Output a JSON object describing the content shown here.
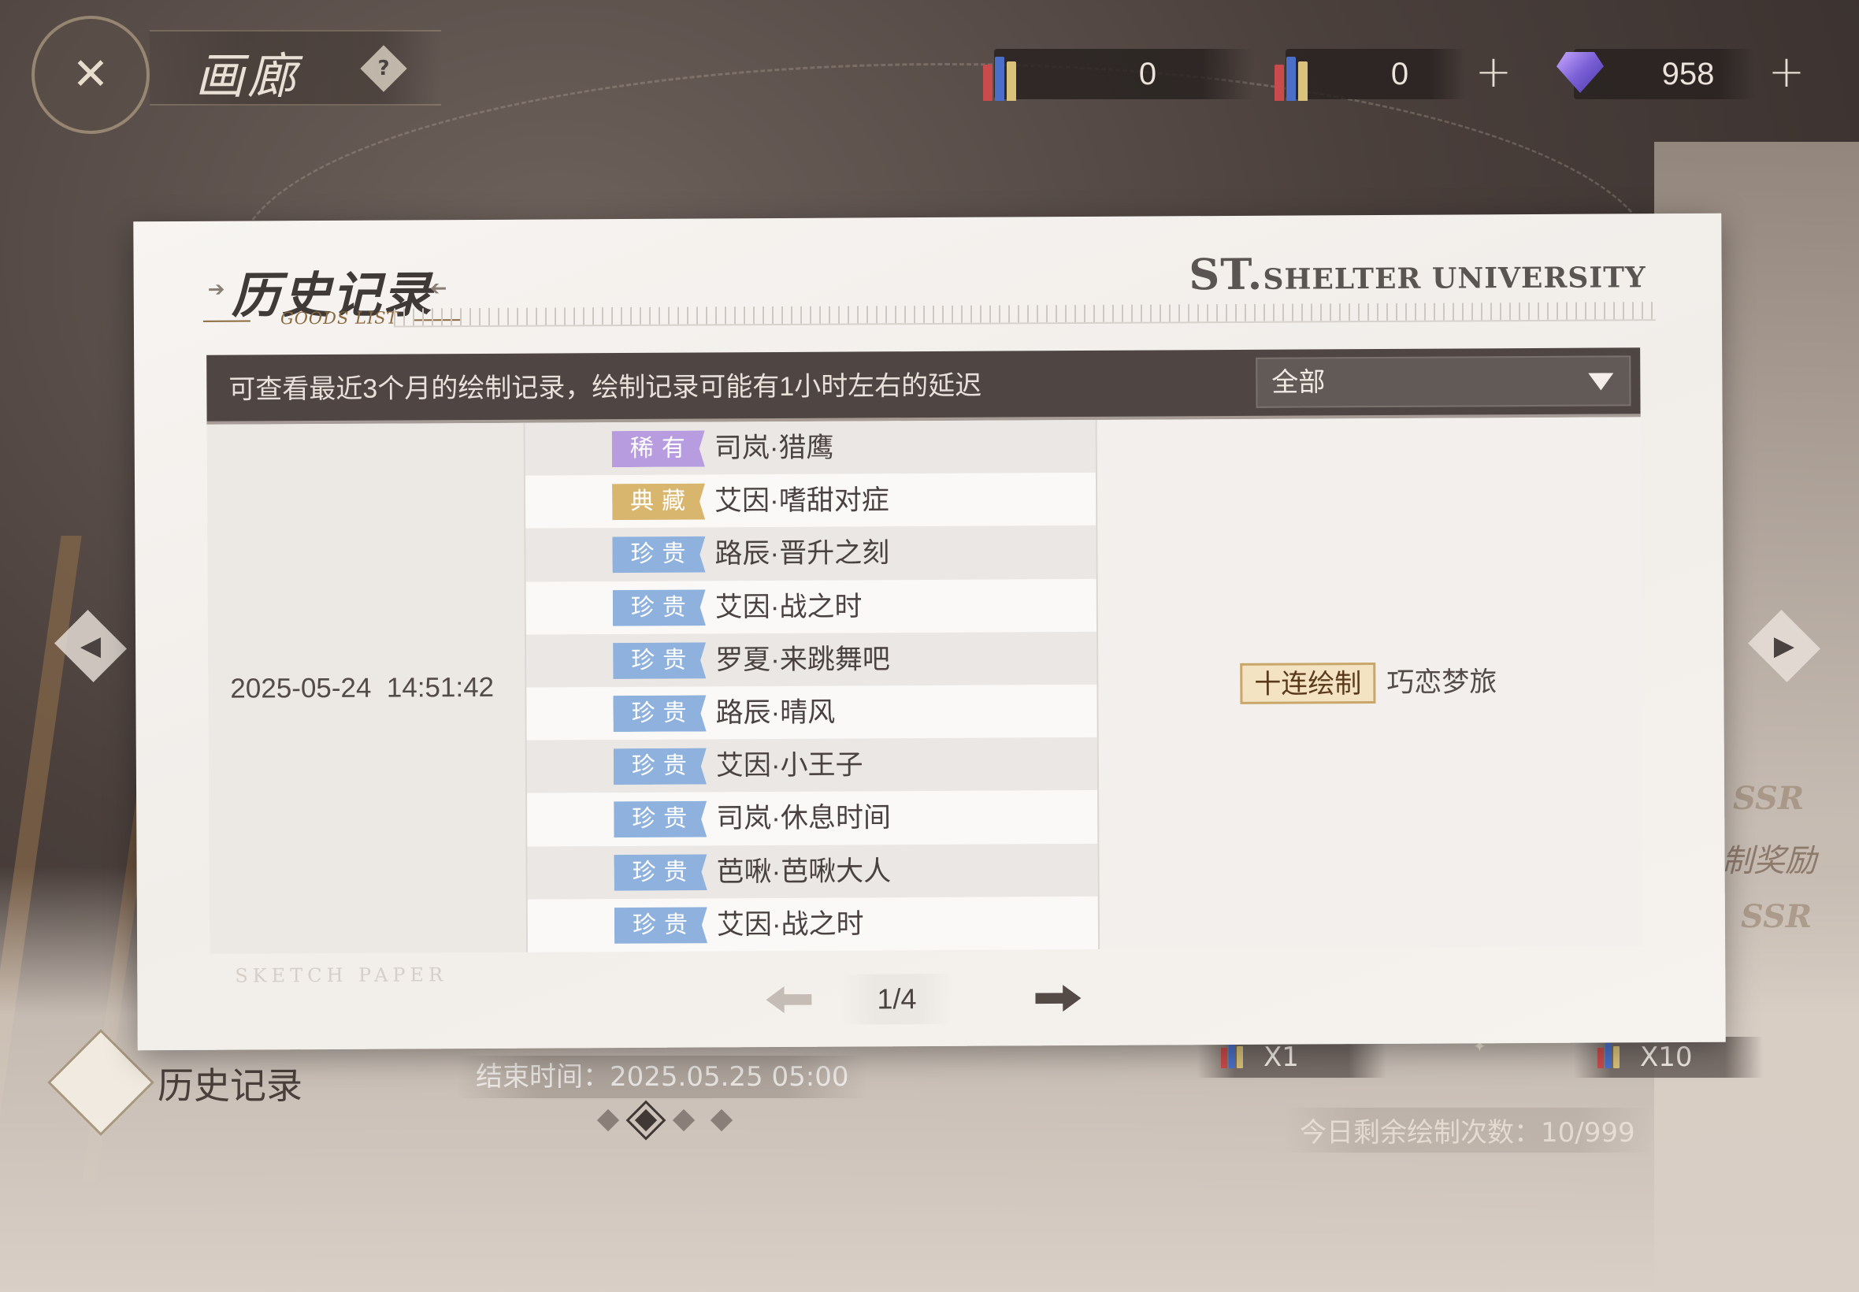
{
  "header": {
    "title": "画廊",
    "help_icon": "question-diamond-icon"
  },
  "currencies": [
    {
      "name": "paint-ticket-icon",
      "value": "0",
      "has_plus": false
    },
    {
      "name": "paint-ticket-icon",
      "value": "0",
      "has_plus": true
    },
    {
      "name": "diamond-gem-icon",
      "value": "958",
      "has_plus": true
    }
  ],
  "plus_label": "+",
  "modal": {
    "title": "历史记录",
    "subtitle": "GOODS LIST",
    "brand_prefix": "ST.",
    "brand_name": "SHELTER UNIVERSITY",
    "info_text": "可查看最近3个月的绘制记录，绘制记录可能有1小时左右的延迟",
    "filter_value": "全部",
    "record": {
      "datetime": "2025-05-24  14:51:42",
      "source_type": "十连绘制",
      "source_name": "巧恋梦旅",
      "items": [
        {
          "rarity": "稀有",
          "rarity_color": "#b79ce0",
          "name": "司岚·猎鹰"
        },
        {
          "rarity": "典藏",
          "rarity_color": "#d9b66e",
          "name": "艾因·嗜甜对症"
        },
        {
          "rarity": "珍贵",
          "rarity_color": "#8fb1dd",
          "name": "路辰·晋升之刻"
        },
        {
          "rarity": "珍贵",
          "rarity_color": "#8fb1dd",
          "name": "艾因·战之时"
        },
        {
          "rarity": "珍贵",
          "rarity_color": "#8fb1dd",
          "name": "罗夏·来跳舞吧"
        },
        {
          "rarity": "珍贵",
          "rarity_color": "#8fb1dd",
          "name": "路辰·晴风"
        },
        {
          "rarity": "珍贵",
          "rarity_color": "#8fb1dd",
          "name": "艾因·小王子"
        },
        {
          "rarity": "珍贵",
          "rarity_color": "#8fb1dd",
          "name": "司岚·休息时间"
        },
        {
          "rarity": "珍贵",
          "rarity_color": "#8fb1dd",
          "name": "芭啾·芭啾大人"
        },
        {
          "rarity": "珍贵",
          "rarity_color": "#8fb1dd",
          "name": "艾因·战之时"
        }
      ]
    },
    "sketch_label": "SKETCH PAPER",
    "pager": {
      "page": "1/4"
    }
  },
  "background_ui": {
    "history_label": "历史记录",
    "end_time": "结束时间：2025.05.25  05:00",
    "draw_x1": "X1",
    "draw_x10": "X10",
    "remaining": "今日剩余绘制次数：10/999",
    "reward_text": "制奖励",
    "ssr_badge": "SSR"
  },
  "colors": {
    "accent_gold": "#c9a76a",
    "rare_purple": "#b79ce0",
    "collection_gold": "#d9b66e",
    "precious_blue": "#8fb1dd",
    "info_bar": "#4f4644"
  }
}
